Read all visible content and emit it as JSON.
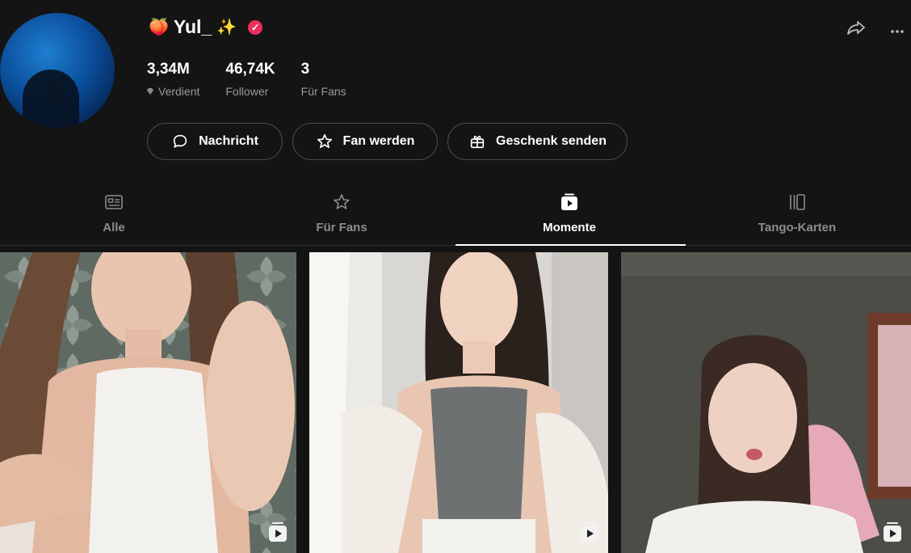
{
  "profile": {
    "name": "Yul_",
    "emoji_before": "🍑",
    "emoji_after": "✨",
    "verified": true
  },
  "stats": [
    {
      "value": "3,34M",
      "label": "Verdient",
      "icon": "diamond-icon"
    },
    {
      "value": "46,74K",
      "label": "Follower"
    },
    {
      "value": "3",
      "label": "Für Fans"
    }
  ],
  "actions": {
    "message": "Nachricht",
    "fan": "Fan werden",
    "gift": "Geschenk senden"
  },
  "tabs": [
    {
      "label": "Alle",
      "icon": "id-card-icon"
    },
    {
      "label": "Für Fans",
      "icon": "star-icon"
    },
    {
      "label": "Momente",
      "icon": "moments-play-icon",
      "active": true
    },
    {
      "label": "Tango-Karten",
      "icon": "cards-icon"
    }
  ],
  "colors": {
    "background": "#141414",
    "verified_badge": "#e8305a",
    "tab_inactive": "#8c8c8c"
  }
}
